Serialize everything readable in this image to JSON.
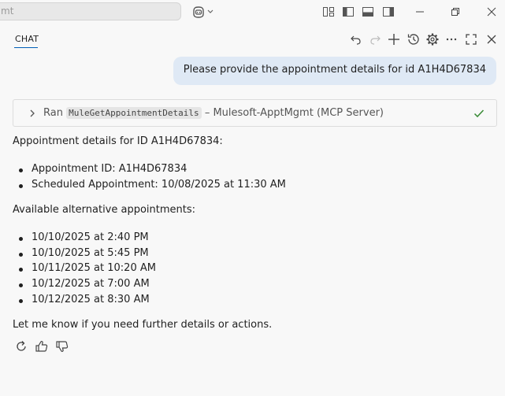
{
  "titlebar": {
    "search_text": "mt",
    "icons": [
      "copilot-icon",
      "chevron-down-icon",
      "customize-layout-icon",
      "toggle-primary-sidebar-icon",
      "toggle-panel-icon",
      "toggle-secondary-sidebar-icon",
      "minimize-icon",
      "restore-icon",
      "close-icon"
    ]
  },
  "chat": {
    "tab_label": "CHAT",
    "actions": [
      "undo-icon",
      "redo-icon",
      "new-chat-icon",
      "history-icon",
      "settings-icon",
      "more-icon",
      "maximize-icon",
      "close-icon"
    ]
  },
  "user_message": "Please provide the appointment details for id A1H4D67834",
  "tool_call": {
    "prefix": "Ran",
    "tool_name": "MuleGetAppointmentDetails",
    "suffix": "– Mulesoft-ApptMgmt (MCP Server)",
    "status": "success"
  },
  "response": {
    "intro": "Appointment details for ID A1H4D67834:",
    "details": [
      "Appointment ID: A1H4D67834",
      "Scheduled Appointment: 10/08/2025 at 11:30 AM"
    ],
    "alt_heading": "Available alternative appointments:",
    "alternatives": [
      "10/10/2025 at 2:40 PM",
      "10/10/2025 at 5:45 PM",
      "10/11/2025 at 10:20 AM",
      "10/12/2025 at 7:00 AM",
      "10/12/2025 at 8:30 AM"
    ],
    "closing": "Let me know if you need further details or actions."
  },
  "feedback": [
    "retry-icon",
    "thumbs-up-icon",
    "thumbs-down-icon"
  ],
  "colors": {
    "accent": "#005fb8",
    "user_bubble": "#dfe9f5",
    "success": "#388a34"
  }
}
